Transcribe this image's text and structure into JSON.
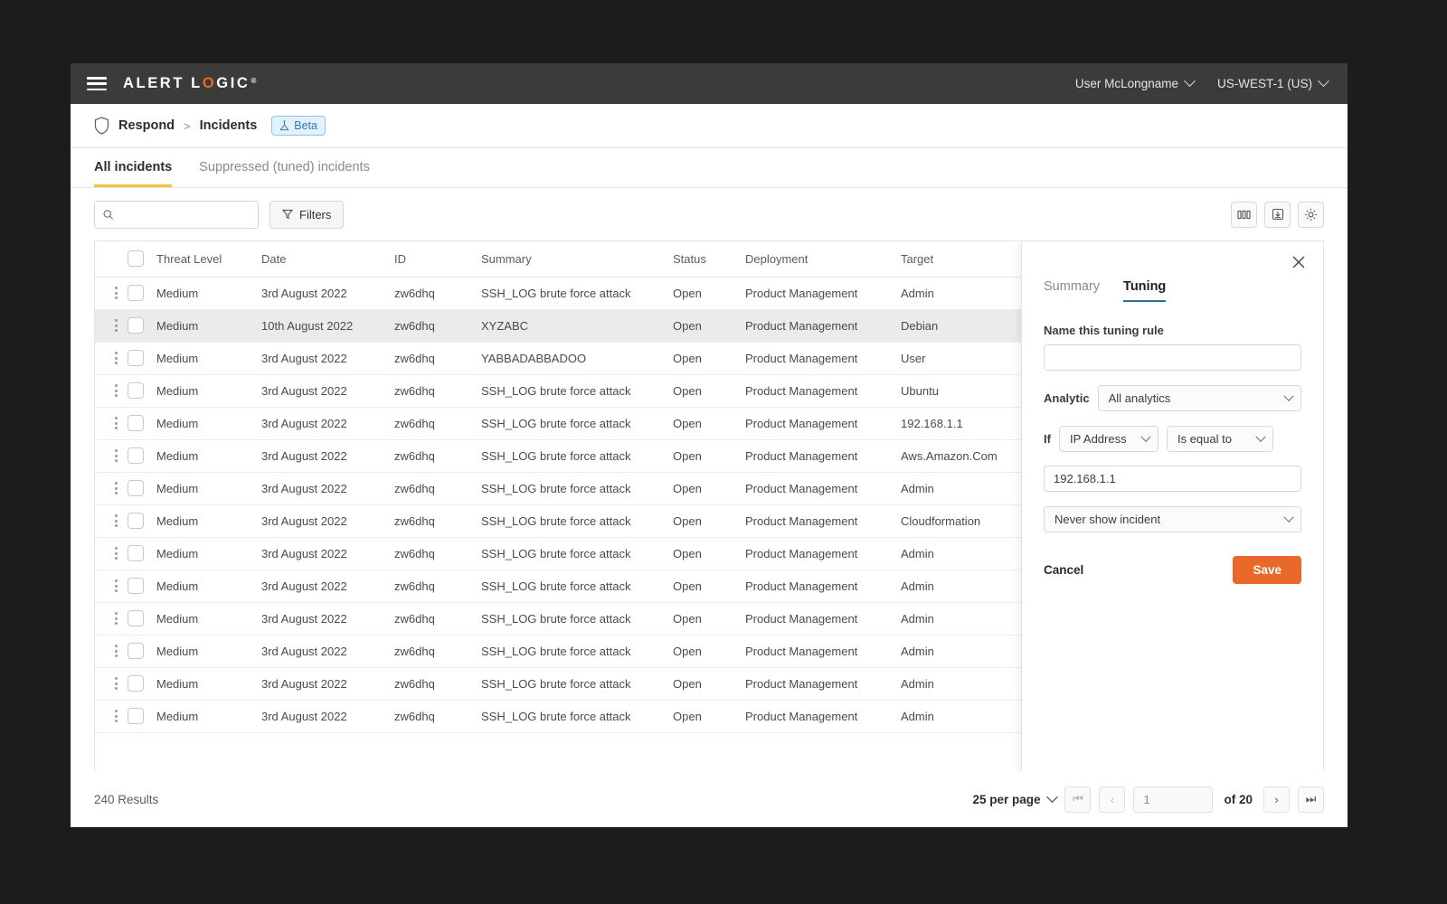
{
  "topnav": {
    "brand_pre": "ALERT L",
    "brand_o": "O",
    "brand_post": "GIC",
    "registered": "®",
    "user": "User McLongname",
    "region": "US-WEST-1 (US)"
  },
  "breadcrumb": {
    "root": "Respond",
    "separator": ">",
    "current": "Incidents",
    "badge": "Beta"
  },
  "tabs": [
    {
      "label": "All incidents",
      "active": true
    },
    {
      "label": "Suppressed (tuned) incidents",
      "active": false
    }
  ],
  "toolbar": {
    "search_placeholder": "",
    "search_value": "",
    "filters_label": "Filters",
    "icons": [
      "columns-icon",
      "export-icon",
      "settings-gear-icon"
    ]
  },
  "table": {
    "columns": [
      "Threat Level",
      "Date",
      "ID",
      "Summary",
      "Status",
      "Deployment",
      "Target"
    ],
    "rows": [
      {
        "threat": "Medium",
        "date": "3rd August 2022",
        "id": "zw6dhq",
        "summary": "SSH_LOG brute force attack",
        "status": "Open",
        "deployment": "Product Management",
        "target": "Admin",
        "selected": false
      },
      {
        "threat": "Medium",
        "date": "10th August 2022",
        "id": "zw6dhq",
        "summary": "XYZABC",
        "status": "Open",
        "deployment": "Product Management",
        "target": "Debian",
        "selected": true
      },
      {
        "threat": "Medium",
        "date": "3rd August 2022",
        "id": "zw6dhq",
        "summary": "YABBADABBADOO",
        "status": "Open",
        "deployment": "Product Management",
        "target": "User",
        "selected": false
      },
      {
        "threat": "Medium",
        "date": "3rd August 2022",
        "id": "zw6dhq",
        "summary": "SSH_LOG brute force attack",
        "status": "Open",
        "deployment": "Product Management",
        "target": "Ubuntu",
        "selected": false
      },
      {
        "threat": "Medium",
        "date": "3rd August 2022",
        "id": "zw6dhq",
        "summary": "SSH_LOG brute force attack",
        "status": "Open",
        "deployment": "Product Management",
        "target": "192.168.1.1",
        "selected": false
      },
      {
        "threat": "Medium",
        "date": "3rd August 2022",
        "id": "zw6dhq",
        "summary": "SSH_LOG brute force attack",
        "status": "Open",
        "deployment": "Product Management",
        "target": "Aws.Amazon.Com",
        "selected": false
      },
      {
        "threat": "Medium",
        "date": "3rd August 2022",
        "id": "zw6dhq",
        "summary": "SSH_LOG brute force attack",
        "status": "Open",
        "deployment": "Product Management",
        "target": "Admin",
        "selected": false
      },
      {
        "threat": "Medium",
        "date": "3rd August 2022",
        "id": "zw6dhq",
        "summary": "SSH_LOG brute force attack",
        "status": "Open",
        "deployment": "Product Management",
        "target": "Cloudformation",
        "selected": false
      },
      {
        "threat": "Medium",
        "date": "3rd August 2022",
        "id": "zw6dhq",
        "summary": "SSH_LOG brute force attack",
        "status": "Open",
        "deployment": "Product Management",
        "target": "Admin",
        "selected": false
      },
      {
        "threat": "Medium",
        "date": "3rd August 2022",
        "id": "zw6dhq",
        "summary": "SSH_LOG brute force attack",
        "status": "Open",
        "deployment": "Product Management",
        "target": "Admin",
        "selected": false
      },
      {
        "threat": "Medium",
        "date": "3rd August 2022",
        "id": "zw6dhq",
        "summary": "SSH_LOG brute force attack",
        "status": "Open",
        "deployment": "Product Management",
        "target": "Admin",
        "selected": false
      },
      {
        "threat": "Medium",
        "date": "3rd August 2022",
        "id": "zw6dhq",
        "summary": "SSH_LOG brute force attack",
        "status": "Open",
        "deployment": "Product Management",
        "target": "Admin",
        "selected": false
      },
      {
        "threat": "Medium",
        "date": "3rd August 2022",
        "id": "zw6dhq",
        "summary": "SSH_LOG brute force attack",
        "status": "Open",
        "deployment": "Product Management",
        "target": "Admin",
        "selected": false
      },
      {
        "threat": "Medium",
        "date": "3rd August 2022",
        "id": "zw6dhq",
        "summary": "SSH_LOG brute force attack",
        "status": "Open",
        "deployment": "Product Management",
        "target": "Admin",
        "selected": false
      }
    ]
  },
  "panel": {
    "tabs": [
      {
        "label": "Summary",
        "active": false
      },
      {
        "label": "Tuning",
        "active": true
      }
    ],
    "name_label": "Name this tuning rule",
    "name_value": "",
    "analytic_label": "Analytic",
    "analytic_value": "All analytics",
    "if_label": "If",
    "field_value": "IP Address",
    "operator_value": "Is equal to",
    "condition_value": "192.168.1.1",
    "action_value": "Never show incident",
    "cancel_label": "Cancel",
    "save_label": "Save"
  },
  "footer": {
    "results": "240 Results",
    "per_page": "25 per page",
    "page_value": "1",
    "of_label": "of 20"
  },
  "colors": {
    "brand_orange": "#ec6726",
    "save_orange": "#e8692a",
    "tab_underline": "#f5c33b",
    "panel_tab_underline": "#2c6f9b",
    "beta_blue": "#2b7cb8",
    "topnav_bg": "#3b3b3b"
  }
}
